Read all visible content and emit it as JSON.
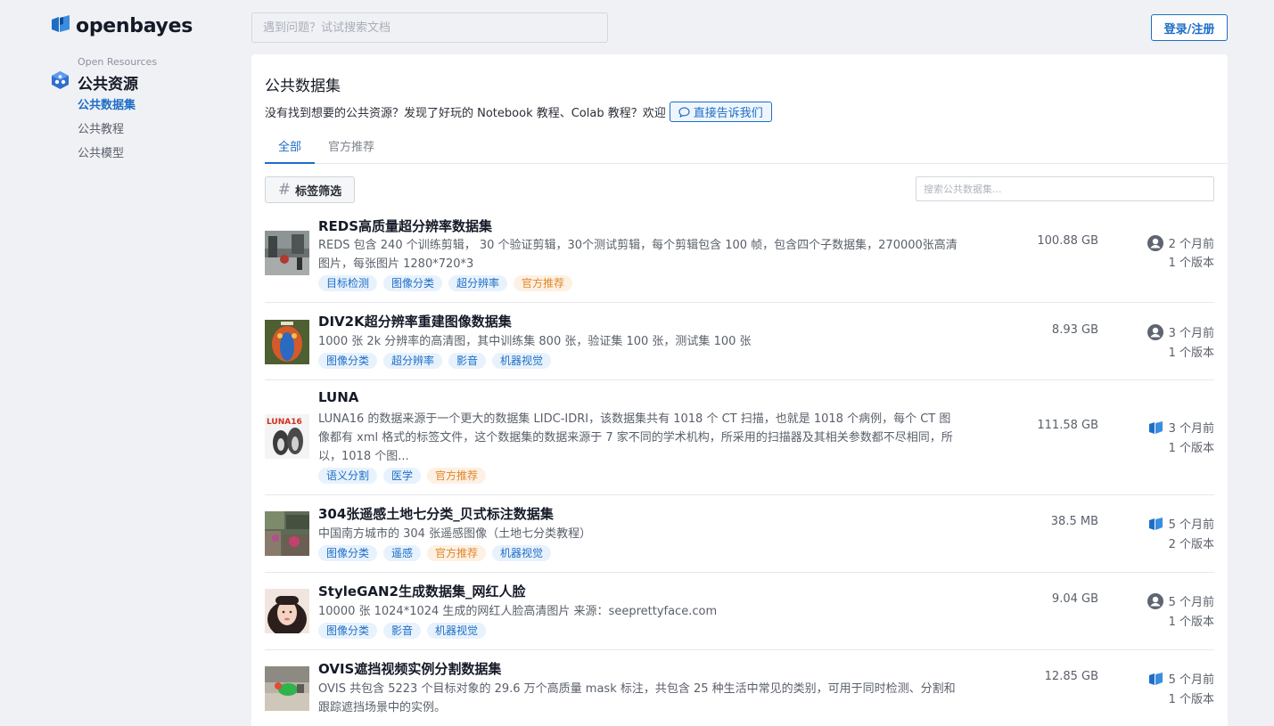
{
  "header": {
    "logo_text": "openbayes",
    "search_placeholder": "遇到问题？试试搜索文档",
    "login_label": "登录/注册"
  },
  "sidebar": {
    "caption": "Open Resources",
    "title": "公共资源",
    "items": [
      {
        "label": "公共数据集",
        "active": true
      },
      {
        "label": "公共教程",
        "active": false
      },
      {
        "label": "公共模型",
        "active": false
      }
    ]
  },
  "main": {
    "title": "公共数据集",
    "intro": "没有找到想要的公共资源？发现了好玩的 Notebook 教程、Colab 教程？欢迎",
    "intro_link": "直接告诉我们",
    "tabs": [
      {
        "label": "全部",
        "active": true
      },
      {
        "label": "官方推荐",
        "active": false
      }
    ],
    "tag_filter_label": "标签筛选",
    "search_placeholder": "搜索公共数据集..."
  },
  "datasets": [
    {
      "name": "REDS高质量超分辨率数据集",
      "description": "REDS 包含 240 个训练剪辑， 30 个验证剪辑，30个测试剪辑，每个剪辑包含 100 帧，包含四个子数据集，270000张高清图片，每张图片 1280*720*3",
      "tags": [
        {
          "label": "目标检测",
          "official": false
        },
        {
          "label": "图像分类",
          "official": false
        },
        {
          "label": "超分辨率",
          "official": false
        },
        {
          "label": "官方推荐",
          "official": true
        }
      ],
      "size": "100.88 GB",
      "updated": "2 个月前",
      "versions": "1 个版本",
      "owner_icon": "user-avatar-icon"
    },
    {
      "name": "DIV2K超分辨率重建图像数据集",
      "description": "1000 张 2k 分辨率的高清图，其中训练集 800 张，验证集 100 张，测试集 100 张",
      "tags": [
        {
          "label": "图像分类",
          "official": false
        },
        {
          "label": "超分辨率",
          "official": false
        },
        {
          "label": "影音",
          "official": false
        },
        {
          "label": "机器视觉",
          "official": false
        }
      ],
      "size": "8.93 GB",
      "updated": "3 个月前",
      "versions": "1 个版本",
      "owner_icon": "user-avatar-icon"
    },
    {
      "name": "LUNA",
      "description": "LUNA16 的数据来源于一个更大的数据集 LIDC-IDRI，该数据集共有 1018 个 CT 扫描，也就是 1018 个病例，每个 CT 图像都有 xml 格式的标签文件，这个数据集的数据来源于 7 家不同的学术机构，所采用的扫描器及其相关参数都不尽相同，所以，1018 个图...",
      "tags": [
        {
          "label": "语义分割",
          "official": false
        },
        {
          "label": "医学",
          "official": false
        },
        {
          "label": "官方推荐",
          "official": true
        }
      ],
      "size": "111.58 GB",
      "updated": "3 个月前",
      "versions": "1 个版本",
      "owner_icon": "openbayes-logo-icon",
      "thumb_text": "LUNA16"
    },
    {
      "name": "304张遥感土地七分类_贝式标注数据集",
      "description": "中国南方城市的 304 张遥感图像（土地七分类教程）",
      "tags": [
        {
          "label": "图像分类",
          "official": false
        },
        {
          "label": "遥感",
          "official": false
        },
        {
          "label": "官方推荐",
          "official": true
        },
        {
          "label": "机器视觉",
          "official": false
        }
      ],
      "size": "38.5 MB",
      "updated": "5 个月前",
      "versions": "2 个版本",
      "owner_icon": "openbayes-logo-icon"
    },
    {
      "name": "StyleGAN2生成数据集_网红人脸",
      "description": "10000 张 1024*1024 生成的网红人脸高清图片 来源：seeprettyface.com",
      "tags": [
        {
          "label": "图像分类",
          "official": false
        },
        {
          "label": "影音",
          "official": false
        },
        {
          "label": "机器视觉",
          "official": false
        }
      ],
      "size": "9.04 GB",
      "updated": "5 个月前",
      "versions": "1 个版本",
      "owner_icon": "user-avatar-icon"
    },
    {
      "name": "OVIS遮挡视频实例分割数据集",
      "description": "OVIS 共包含 5223 个目标对象的 29.6 万个高质量 mask 标注，共包含 25 种生活中常见的类别，可用于同时检测、分割和跟踪遮挡场景中的实例。",
      "tags": [],
      "size": "12.85 GB",
      "updated": "5 个月前",
      "versions": "1 个版本",
      "owner_icon": "openbayes-logo-icon"
    }
  ],
  "colors": {
    "accent": "#1d6ec6",
    "official_tag_text": "#e0872a",
    "official_tag_bg": "#fdf1e4",
    "tag_bg": "#e8f2fc",
    "page_bg": "#f0f1f5"
  }
}
